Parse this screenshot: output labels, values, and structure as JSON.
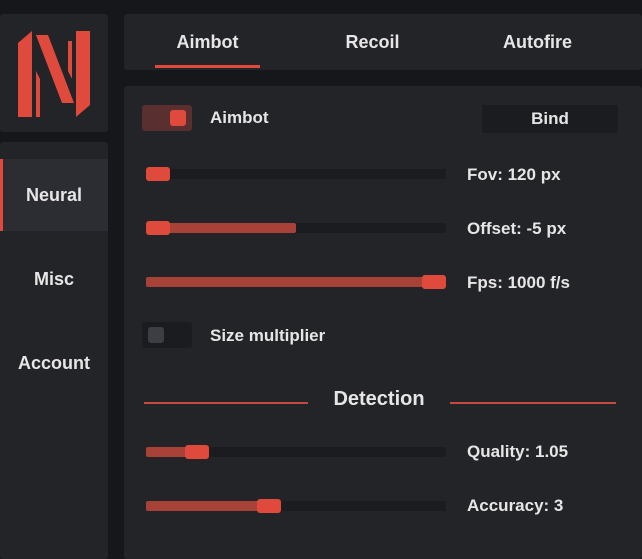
{
  "colors": {
    "accent": "#e04a3c",
    "panel": "#232428",
    "background": "#16171a"
  },
  "logo": {
    "icon": "n-logo-icon"
  },
  "sidebar": {
    "items": [
      {
        "label": "Neural",
        "active": true
      },
      {
        "label": "Misc",
        "active": false
      },
      {
        "label": "Account",
        "active": false
      }
    ]
  },
  "tabs": [
    {
      "label": "Aimbot",
      "active": true
    },
    {
      "label": "Recoil",
      "active": false
    },
    {
      "label": "Autofire",
      "active": false
    }
  ],
  "aimbot": {
    "toggle_label": "Aimbot",
    "enabled": true,
    "bind_label": "Bind",
    "sliders": [
      {
        "label": "Fov: 120 px",
        "value": 0.04
      },
      {
        "label": "Offset: -5 px",
        "value": 0.04
      },
      {
        "label": "Fps: 1000 f/s",
        "value": 0.96
      }
    ],
    "size_multiplier_label": "Size multiplier",
    "size_multiplier_enabled": false
  },
  "detection": {
    "title": "Detection",
    "sliders": [
      {
        "label": "Quality: 1.05",
        "value": 0.17
      },
      {
        "label": "Accuracy: 3",
        "value": 0.41
      }
    ]
  }
}
